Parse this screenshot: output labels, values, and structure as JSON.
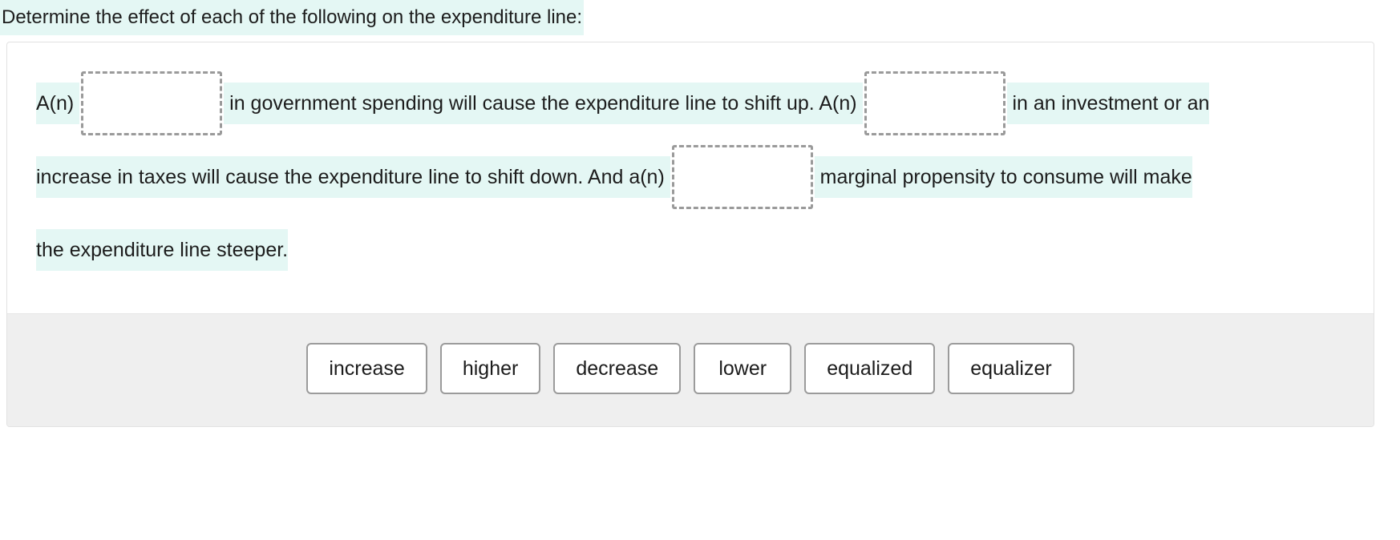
{
  "prompt": {
    "text": "Determine the effect of each of the following on the expenditure line:"
  },
  "statement": {
    "segments": [
      {
        "type": "text",
        "value": "A(n) "
      },
      {
        "type": "dropzone",
        "name": "blank-1",
        "value": ""
      },
      {
        "type": "text",
        "value": " in government spending will cause the expenditure line to shift up. A(n) "
      },
      {
        "type": "dropzone",
        "name": "blank-2",
        "value": ""
      },
      {
        "type": "text",
        "value": " in an investment or an increase in taxes will cause the expenditure line to shift down. And a(n) "
      },
      {
        "type": "dropzone",
        "name": "blank-3",
        "value": ""
      },
      {
        "type": "text",
        "value": " marginal propensity to consume will make the expenditure line steeper."
      }
    ],
    "line1_a": "A(n) ",
    "line1_b": " in government spending will cause the expenditure line to shift up. A(n) ",
    "line1_c": " in an investment or an",
    "line2_a": "increase in taxes will cause the expenditure line to shift down. And a(n) ",
    "line2_b": " marginal propensity to consume will make",
    "line3_a": "the expenditure line steeper."
  },
  "tray": {
    "options": [
      {
        "label": "increase"
      },
      {
        "label": "higher"
      },
      {
        "label": "decrease"
      },
      {
        "label": "lower"
      },
      {
        "label": "equalized"
      },
      {
        "label": "equalizer"
      }
    ]
  },
  "colors": {
    "highlight": "#e4f7f4",
    "tray_background": "#efefef",
    "dropzone_border": "#9a9a9a",
    "tile_border": "#9b9b9b",
    "card_border": "#e2e2e2",
    "text": "#1c1c1c"
  }
}
